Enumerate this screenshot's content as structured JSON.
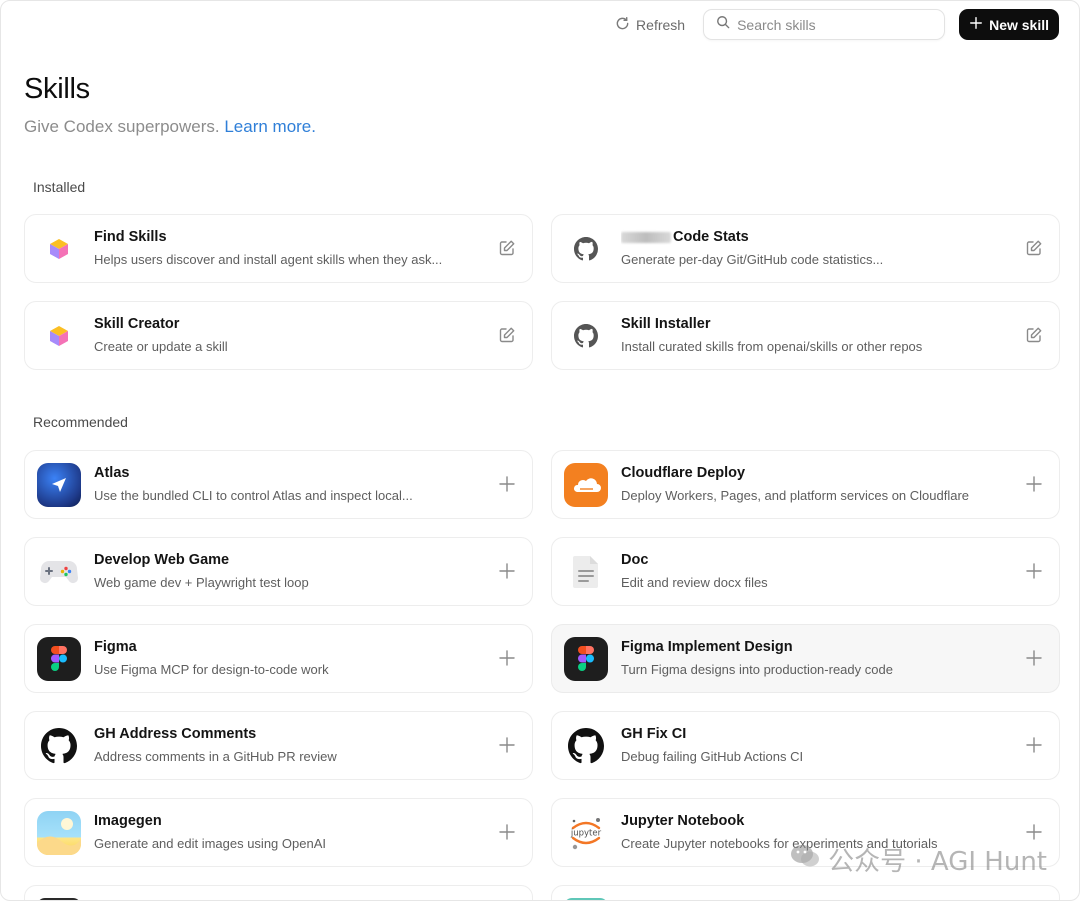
{
  "toolbar": {
    "refresh_label": "Refresh",
    "search_placeholder": "Search skills",
    "new_skill_label": "New skill"
  },
  "header": {
    "title": "Skills",
    "subtitle": "Give Codex superpowers.",
    "learn_more": "Learn more."
  },
  "sections": {
    "installed_label": "Installed",
    "recommended_label": "Recommended"
  },
  "installed": [
    {
      "name": "Find Skills",
      "desc": "Helps users discover and install agent skills when they ask...",
      "icon": "cube-icon",
      "action": "edit-icon"
    },
    {
      "name": "Code Stats",
      "desc": "Generate per-day Git/GitHub code statistics...",
      "icon": "github-icon",
      "action": "edit-icon"
    },
    {
      "name": "Skill Creator",
      "desc": "Create or update a skill",
      "icon": "cube-icon",
      "action": "edit-icon"
    },
    {
      "name": "Skill Installer",
      "desc": "Install curated skills from openai/skills or other repos",
      "icon": "github-icon",
      "action": "edit-icon"
    }
  ],
  "recommended": [
    {
      "name": "Atlas",
      "desc": "Use the bundled CLI to control Atlas and inspect local...",
      "icon": "atlas-icon"
    },
    {
      "name": "Cloudflare Deploy",
      "desc": "Deploy Workers, Pages, and platform services on Cloudflare",
      "icon": "cloudflare-icon"
    },
    {
      "name": "Develop Web Game",
      "desc": "Web game dev + Playwright test loop",
      "icon": "gamepad-icon"
    },
    {
      "name": "Doc",
      "desc": "Edit and review docx files",
      "icon": "document-icon"
    },
    {
      "name": "Figma",
      "desc": "Use Figma MCP for design-to-code work",
      "icon": "figma-icon"
    },
    {
      "name": "Figma Implement Design",
      "desc": "Turn Figma designs into production-ready code",
      "icon": "figma-icon"
    },
    {
      "name": "GH Address Comments",
      "desc": "Address comments in a GitHub PR review",
      "icon": "github-icon"
    },
    {
      "name": "GH Fix CI",
      "desc": "Debug failing GitHub Actions CI",
      "icon": "github-icon"
    },
    {
      "name": "Imagegen",
      "desc": "Generate and edit images using OpenAI",
      "icon": "image-icon"
    },
    {
      "name": "Jupyter Notebook",
      "desc": "Create Jupyter notebooks for experiments and tutorials",
      "icon": "jupyter-icon"
    }
  ],
  "jupyter_icon_text": "jupyter",
  "watermark": "公众号 · AGI Hunt",
  "colors": {
    "accent_link": "#2f7fd8",
    "button_bg": "#0d0d0d",
    "cloudflare": "#f38020",
    "atlas": "#1e3a8a"
  }
}
